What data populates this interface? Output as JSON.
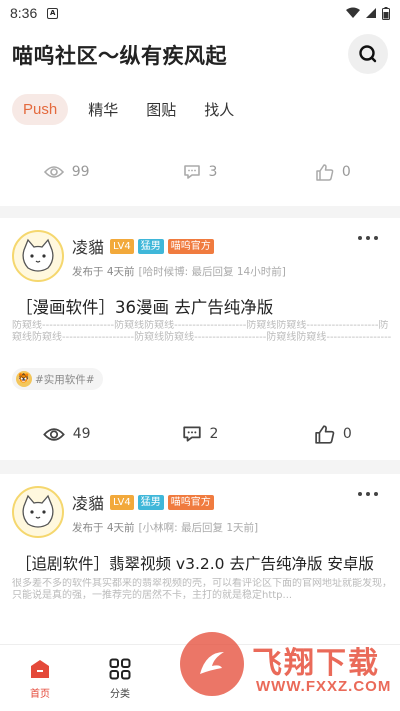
{
  "status_bar": {
    "time": "8:36",
    "notif_letter": "A"
  },
  "app": {
    "title": "喵呜社区～纵有疾风起"
  },
  "tabs": [
    {
      "label": "Push",
      "active": true
    },
    {
      "label": "精华",
      "active": false
    },
    {
      "label": "图贴",
      "active": false
    },
    {
      "label": "找人",
      "active": false
    }
  ],
  "top_card": {
    "views": "99",
    "comments": "3",
    "likes": "0"
  },
  "posts": [
    {
      "author": "凌貓",
      "badges": [
        "LV4",
        "猛男",
        "喵呜官方"
      ],
      "posted": "发布于 4天前",
      "reply": "[哈时候博: 最后回复 14小时前]",
      "title": "［漫画软件］36漫画 去广告纯净版",
      "body": "防窥线--------------------防窥线防窥线--------------------防窥线防窥线--------------------防窥线防窥线--------------------防窥线防窥线--------------------防窥线防窥线--------------------",
      "tag": "#实用软件#",
      "views": "49",
      "comments": "2",
      "likes": "0"
    },
    {
      "author": "凌貓",
      "badges": [
        "LV4",
        "猛男",
        "喵呜官方"
      ],
      "posted": "发布于 4天前",
      "reply": "[小林啊: 最后回复 1天前]",
      "title": "［追剧软件］翡翠视频 v3.2.0 去广告纯净版 安卓版",
      "body": "很多差不多的软件其实都来的翡翠视频的壳，可以看评论区下面的官网地址就能发现，只能说是真的强，一推荐完的居然不卡，主打的就是稳定http..."
    }
  ],
  "bottom_nav": [
    {
      "label": "首页",
      "icon": "home-icon",
      "active": true
    },
    {
      "label": "分类",
      "icon": "grid-icon",
      "active": false
    },
    {
      "label": "",
      "icon": "",
      "active": false
    },
    {
      "label": "",
      "icon": "",
      "active": false
    },
    {
      "label": "",
      "icon": "",
      "active": false
    }
  ],
  "watermark": {
    "text": "飞翔下载",
    "url": "WWW.FXXZ.COM"
  },
  "colors": {
    "accent": "#e46a3e",
    "tab_active_bg": "#f7e9e5",
    "nav_active": "#e4493a"
  }
}
